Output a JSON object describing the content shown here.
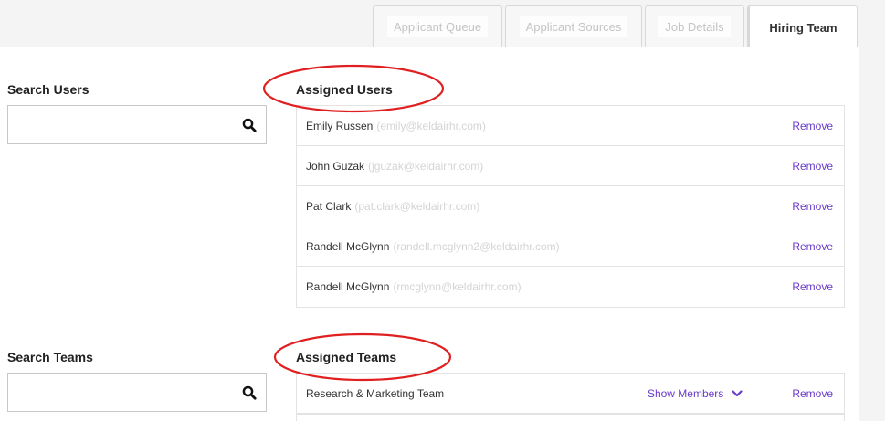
{
  "tabs": [
    {
      "label": "Applicant Queue",
      "active": false
    },
    {
      "label": "Applicant Sources",
      "active": false
    },
    {
      "label": "Job Details",
      "active": false
    },
    {
      "label": "Hiring Team",
      "active": true
    }
  ],
  "search_users": {
    "label": "Search Users",
    "placeholder": "",
    "value": ""
  },
  "assigned_users": {
    "label": "Assigned Users",
    "remove_label": "Remove",
    "items": [
      {
        "name": "Emily Russen",
        "email": "(emily@keldairhr.com)"
      },
      {
        "name": "John Guzak",
        "email": "(jguzak@keldairhr.com)"
      },
      {
        "name": "Pat Clark",
        "email": "(pat.clark@keldairhr.com)"
      },
      {
        "name": "Randell McGlynn",
        "email": "(randell.mcglynn2@keldairhr.com)"
      },
      {
        "name": "Randell McGlynn",
        "email": "(rmcglynn@keldairhr.com)"
      }
    ]
  },
  "search_teams": {
    "label": "Search Teams",
    "placeholder": "",
    "value": ""
  },
  "assigned_teams": {
    "label": "Assigned Teams",
    "show_members_label": "Show Members",
    "remove_label": "Remove",
    "items": [
      {
        "name": "Research & Marketing Team"
      }
    ]
  },
  "colors": {
    "accent": "#6a3bc9",
    "annotation": "#e02020"
  },
  "icons": {
    "search": "search-icon",
    "chevron": "chevron-down-icon"
  }
}
